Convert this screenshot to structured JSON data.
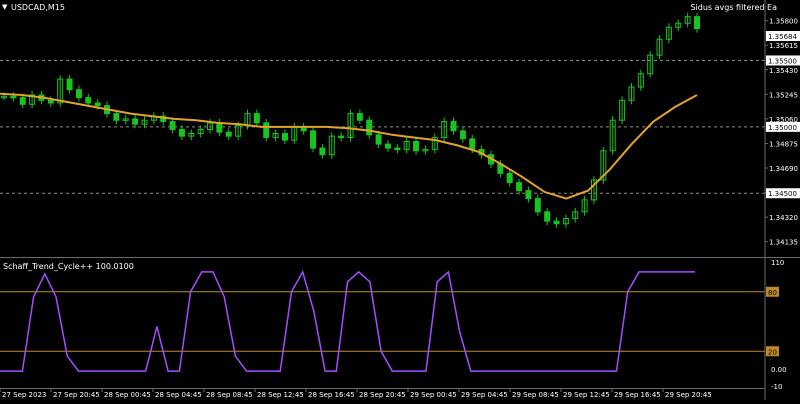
{
  "symbol": "USDCAD,M15",
  "indicator_name": "Sidus avgs filtered Ea",
  "oscillator_label": "Schaff_Trend_Cycle++ 100.0100",
  "colors": {
    "background": "#000000",
    "candle": "#19c41e",
    "moving_average": "#e3a22a",
    "oscillator": "#a64dff",
    "level_line": "#c08a2a",
    "grid_dash": "#8a8a8a",
    "axis_text": "#ffffff"
  },
  "price_scale": {
    "min": 1.3405,
    "max": 1.3588,
    "ticks": [
      "1.35800",
      "1.35615",
      "1.35430",
      "1.35245",
      "1.35060",
      "1.34875",
      "1.34690",
      "1.34505",
      "1.34320",
      "1.34135"
    ],
    "highlight_ticks": [
      "1.35684",
      "1.35500",
      "1.35000",
      "1.34500"
    ],
    "dashed_levels": [
      1.355,
      1.35,
      1.345
    ]
  },
  "oscillator_scale": {
    "min": -10,
    "max": 110,
    "ticks": [
      "110",
      "0.00",
      "-10"
    ],
    "levels": [
      "80",
      "20"
    ]
  },
  "time_labels": [
    "27 Sep 2023",
    "27 Sep 20:45",
    "28 Sep 00:45",
    "28 Sep 04:45",
    "28 Sep 08:45",
    "28 Sep 12:45",
    "28 Sep 16:45",
    "28 Sep 20:45",
    "29 Sep 00:45",
    "29 Sep 04:45",
    "29 Sep 08:45",
    "29 Sep 12:45",
    "29 Sep 16:45",
    "29 Sep 20:45"
  ],
  "chart_data": {
    "type": "line",
    "series": [
      {
        "name": "USDCAD,M15",
        "values": [
          1.3523,
          1.3522,
          1.3517,
          1.3524,
          1.352,
          1.3518,
          1.3536,
          1.3528,
          1.3522,
          1.3518,
          1.3516,
          1.351,
          1.3505,
          1.3506,
          1.3502,
          1.3505,
          1.3508,
          1.3504,
          1.3498,
          1.3493,
          1.3495,
          1.3498,
          1.3503,
          1.3496,
          1.3493,
          1.3501,
          1.351,
          1.3503,
          1.3492,
          1.3495,
          1.349,
          1.35,
          1.3497,
          1.3484,
          1.3479,
          1.3493,
          1.3492,
          1.351,
          1.3505,
          1.3494,
          1.3487,
          1.3484,
          1.3483,
          1.3489,
          1.3482,
          1.3483,
          1.3492,
          1.3504,
          1.3497,
          1.3491,
          1.3483,
          1.3479,
          1.3472,
          1.3465,
          1.3458,
          1.3452,
          1.3446,
          1.3436,
          1.3429,
          1.3427,
          1.3431,
          1.3436,
          1.3445,
          1.346,
          1.3482,
          1.3505,
          1.352,
          1.353,
          1.354,
          1.3554,
          1.3566,
          1.3575,
          1.3578,
          1.3583,
          1.3574
        ]
      },
      {
        "name": "Sidus avgs filtered Ea",
        "values": [
          1.3525,
          1.3524,
          1.3522,
          1.3519,
          1.3516,
          1.3513,
          1.351,
          1.3508,
          1.3506,
          1.3505,
          1.3503,
          1.3502,
          1.35,
          1.35,
          1.35,
          1.35,
          1.3499,
          1.3497,
          1.3494,
          1.3492,
          1.349,
          1.3486,
          1.3481,
          1.3472,
          1.3462,
          1.3451,
          1.3446,
          1.3452,
          1.3468,
          1.3487,
          1.3504,
          1.3515,
          1.3524
        ]
      },
      {
        "name": "Schaff_Trend_Cycle++",
        "values": [
          0,
          0,
          0,
          75,
          98,
          75,
          15,
          0,
          0,
          0,
          0,
          0,
          0,
          0,
          45,
          0,
          0,
          80,
          100,
          100,
          75,
          15,
          0,
          0,
          0,
          0,
          80,
          100,
          60,
          0,
          0,
          90,
          100,
          90,
          20,
          0,
          0,
          0,
          0,
          90,
          100,
          40,
          0,
          0,
          0,
          0,
          0,
          0,
          0,
          0,
          0,
          0,
          0,
          0,
          0,
          0,
          80,
          100,
          100,
          100,
          100,
          100,
          100
        ]
      }
    ],
    "levels": [
      80,
      20
    ]
  }
}
